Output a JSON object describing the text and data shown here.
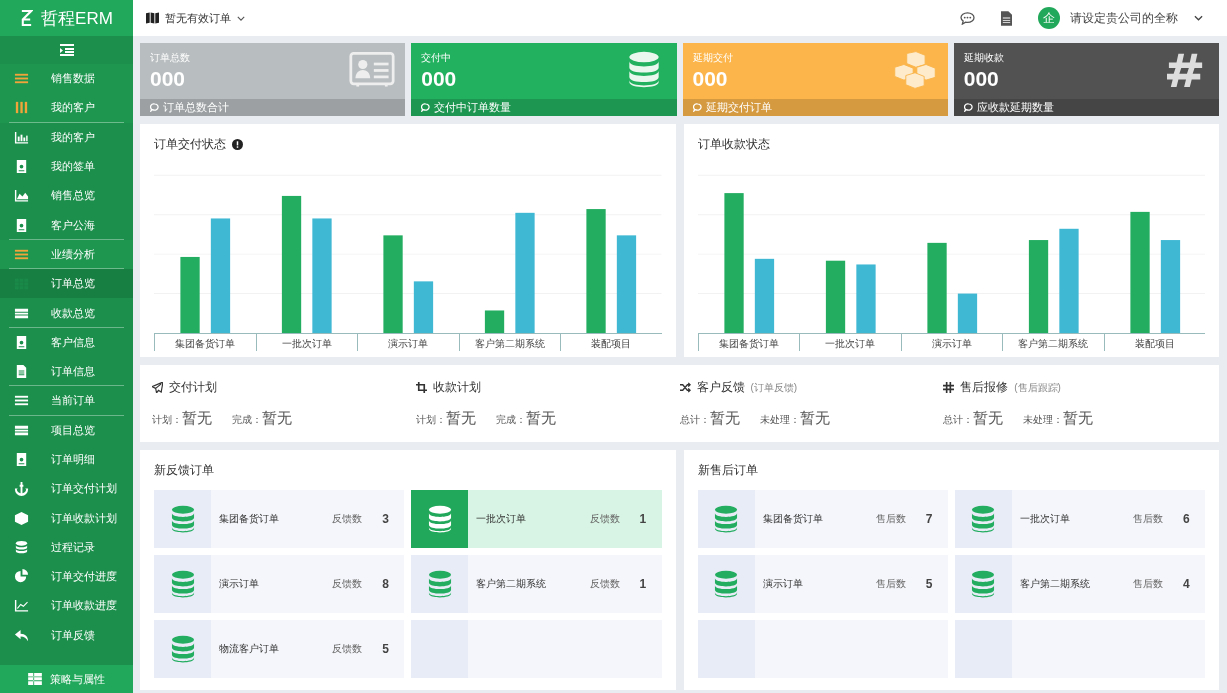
{
  "sidebar": {
    "logo": "哲程ERM",
    "items": [
      {
        "label": "销售数据",
        "kind": "group",
        "selected": false,
        "divider_after": false
      },
      {
        "label": "我的客户",
        "kind": "group",
        "selected": false,
        "divider_after": true
      },
      {
        "label": "我的客户",
        "kind": "item",
        "selected": false,
        "divider_after": false
      },
      {
        "label": "我的签单",
        "kind": "item",
        "selected": false,
        "divider_after": false
      },
      {
        "label": "销售总览",
        "kind": "item",
        "selected": false,
        "divider_after": false
      },
      {
        "label": "客户公海",
        "kind": "item",
        "selected": false,
        "divider_after": true
      },
      {
        "label": "业绩分析",
        "kind": "group",
        "selected": false,
        "divider_after": true
      },
      {
        "label": "订单总览",
        "kind": "item",
        "selected": true,
        "divider_after": false
      },
      {
        "label": "收款总览",
        "kind": "item",
        "selected": false,
        "divider_after": true
      },
      {
        "label": "客户信息",
        "kind": "item",
        "selected": false,
        "divider_after": false
      },
      {
        "label": "订单信息",
        "kind": "item",
        "selected": false,
        "divider_after": true
      },
      {
        "label": "当前订单",
        "kind": "item",
        "selected": false,
        "divider_after": true
      },
      {
        "label": "项目总览",
        "kind": "item",
        "selected": false,
        "divider_after": false
      },
      {
        "label": "订单明细",
        "kind": "item",
        "selected": false,
        "divider_after": false
      },
      {
        "label": "订单交付计划",
        "kind": "item",
        "selected": false,
        "divider_after": false
      },
      {
        "label": "订单收款计划",
        "kind": "item",
        "selected": false,
        "divider_after": false
      },
      {
        "label": "过程记录",
        "kind": "item",
        "selected": false,
        "divider_after": false
      },
      {
        "label": "订单交付进度",
        "kind": "item",
        "selected": false,
        "divider_after": false
      },
      {
        "label": "订单收款进度",
        "kind": "item",
        "selected": false,
        "divider_after": false
      },
      {
        "label": "订单反馈",
        "kind": "item",
        "selected": false,
        "divider_after": false
      }
    ],
    "footer": "策略与属性"
  },
  "topbar": {
    "order_filter": "暂无有效订单",
    "avatar": "企",
    "company": "请设定贵公司的全称"
  },
  "stat_cards": [
    {
      "title": "订单总数",
      "value": "000",
      "footer": "订单总数合计",
      "color": "#b8bdbf"
    },
    {
      "title": "交付中",
      "value": "000",
      "footer": "交付中订单数量",
      "color": "#22b15e"
    },
    {
      "title": "延期交付",
      "value": "000",
      "footer": "延期交付订单",
      "color": "#fbb54a"
    },
    {
      "title": "延期收款",
      "value": "000",
      "footer": "应收款延期数量",
      "color": "#525252"
    }
  ],
  "charts": [
    {
      "title": "订单交付状态",
      "info": true,
      "categories": [
        "集团备货订单",
        "一批次订单",
        "演示订单",
        "客户第二期系统",
        "装配项目"
      ]
    },
    {
      "title": "订单收款状态",
      "info": false,
      "categories": [
        "集团备货订单",
        "一批次订单",
        "演示订单",
        "客户第二期系统",
        "装配项目"
      ]
    }
  ],
  "summary": [
    {
      "title": "交付计划",
      "stats": [
        {
          "label": "计划：",
          "value": "暂无"
        },
        {
          "label": "完成：",
          "value": "暂无"
        }
      ]
    },
    {
      "title": "收款计划",
      "stats": [
        {
          "label": "计划：",
          "value": "暂无"
        },
        {
          "label": "完成：",
          "value": "暂无"
        }
      ]
    },
    {
      "title": "客户反馈",
      "note": "(订单反馈)",
      "stats": [
        {
          "label": "总计：",
          "value": "暂无"
        },
        {
          "label": "未处理：",
          "value": "暂无"
        }
      ]
    },
    {
      "title": "售后报修",
      "note": "(售后跟踪)",
      "stats": [
        {
          "label": "总计：",
          "value": "暂无"
        },
        {
          "label": "未处理：",
          "value": "暂无"
        }
      ]
    }
  ],
  "order_panels": [
    {
      "title": "新反馈订单",
      "cards": [
        {
          "kind": "order",
          "name": "集团备货订单",
          "label": "反馈数",
          "count": "3",
          "selected": false
        },
        {
          "kind": "order",
          "name": "一批次订单",
          "label": "反馈数",
          "count": "1",
          "selected": true
        },
        {
          "kind": "order",
          "name": "演示订单",
          "label": "反馈数",
          "count": "8",
          "selected": false
        },
        {
          "kind": "order",
          "name": "客户第二期系统",
          "label": "反馈数",
          "count": "1",
          "selected": false
        },
        {
          "kind": "order",
          "name": "物流客户订单",
          "label": "反馈数",
          "count": "5",
          "selected": false
        },
        {
          "kind": "empty"
        }
      ]
    },
    {
      "title": "新售后订单",
      "cards": [
        {
          "kind": "order",
          "name": "集团备货订单",
          "label": "售后数",
          "count": "7",
          "selected": false
        },
        {
          "kind": "order",
          "name": "一批次订单",
          "label": "售后数",
          "count": "6",
          "selected": false
        },
        {
          "kind": "order",
          "name": "演示订单",
          "label": "售后数",
          "count": "5",
          "selected": false
        },
        {
          "kind": "order",
          "name": "客户第二期系统",
          "label": "售后数",
          "count": "4",
          "selected": false
        },
        {
          "kind": "empty"
        },
        {
          "kind": "empty"
        }
      ]
    }
  ]
}
